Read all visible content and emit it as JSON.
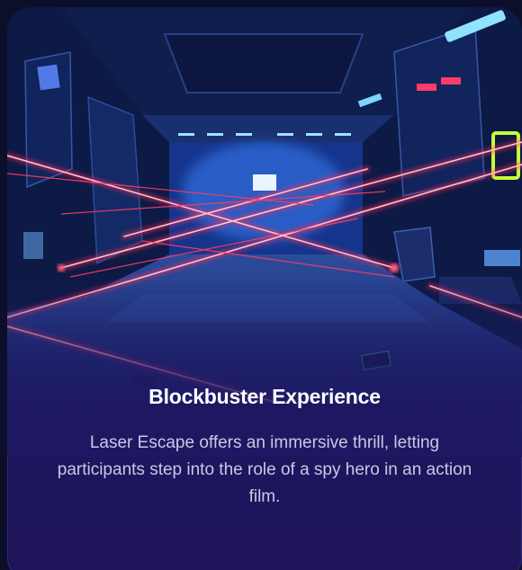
{
  "card": {
    "title": "Blockbuster Experience",
    "description": "Laser Escape offers an immersive thrill, letting participants step into the role of a spy hero in an action film."
  },
  "colors": {
    "page_background": "#0b0f2a",
    "card_background": "#1e1862",
    "laser": "#ff2a55",
    "neon_blue": "#4aa3ff",
    "title_text": "#ffffff",
    "body_text": "#c7c9e4"
  },
  "image": {
    "subject": "sci-fi corridor with red laser beams"
  }
}
